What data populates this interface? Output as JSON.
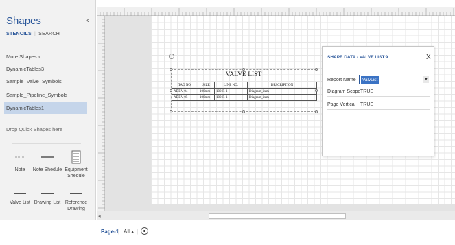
{
  "sidebar": {
    "title": "Shapes",
    "collapse_glyph": "‹",
    "tabs": {
      "stencils": "STENCILS",
      "search": "SEARCH"
    },
    "items": [
      {
        "label": "More Shapes  ›"
      },
      {
        "label": "DynamicTables3"
      },
      {
        "label": "Sample_Valve_Symbols"
      },
      {
        "label": "Sample_Pipeline_Symbols"
      },
      {
        "label": "DynamicTables1"
      }
    ],
    "drop_hint": "Drop Quick Shapes here",
    "stencils": [
      {
        "label": "Note",
        "icon": "note-icon"
      },
      {
        "label": "Note Shedule",
        "icon": "note-schedule-icon"
      },
      {
        "label": "Equipment Shedule",
        "icon": "equipment-schedule-icon"
      },
      {
        "label": "Valve List",
        "icon": "valve-list-icon"
      },
      {
        "label": "Drawing List",
        "icon": "drawing-list-icon"
      },
      {
        "label": "Reference Drawing",
        "icon": "reference-drawing-icon"
      }
    ]
  },
  "valve_list": {
    "title": "VALVE LIST",
    "headers": [
      "TAG NO.",
      "SIZE",
      "LINE NO.",
      "DESCRIPTION"
    ],
    "rows": [
      [
        "ADBV-04",
        "100mm",
        "100-R-1",
        "Diagram_item"
      ],
      [
        "ADBV-05",
        "100mm",
        "100-R-1",
        "Diagram_item"
      ]
    ]
  },
  "shape_data": {
    "title": "SHAPE DATA - VALVE LIST.9",
    "close": "X",
    "rows": [
      {
        "key": "Report Name",
        "value": "ValvList"
      },
      {
        "key": "Diagram Scope",
        "value": "TRUE"
      },
      {
        "key": "Page Vertical",
        "value": "TRUE"
      }
    ]
  },
  "page_tabs": {
    "current": "Page-1",
    "all": "All ▴"
  },
  "colors": {
    "accent": "#2b579a",
    "selected_item": "#c5d5ea",
    "sidebar_bg": "#f2f2f2"
  }
}
